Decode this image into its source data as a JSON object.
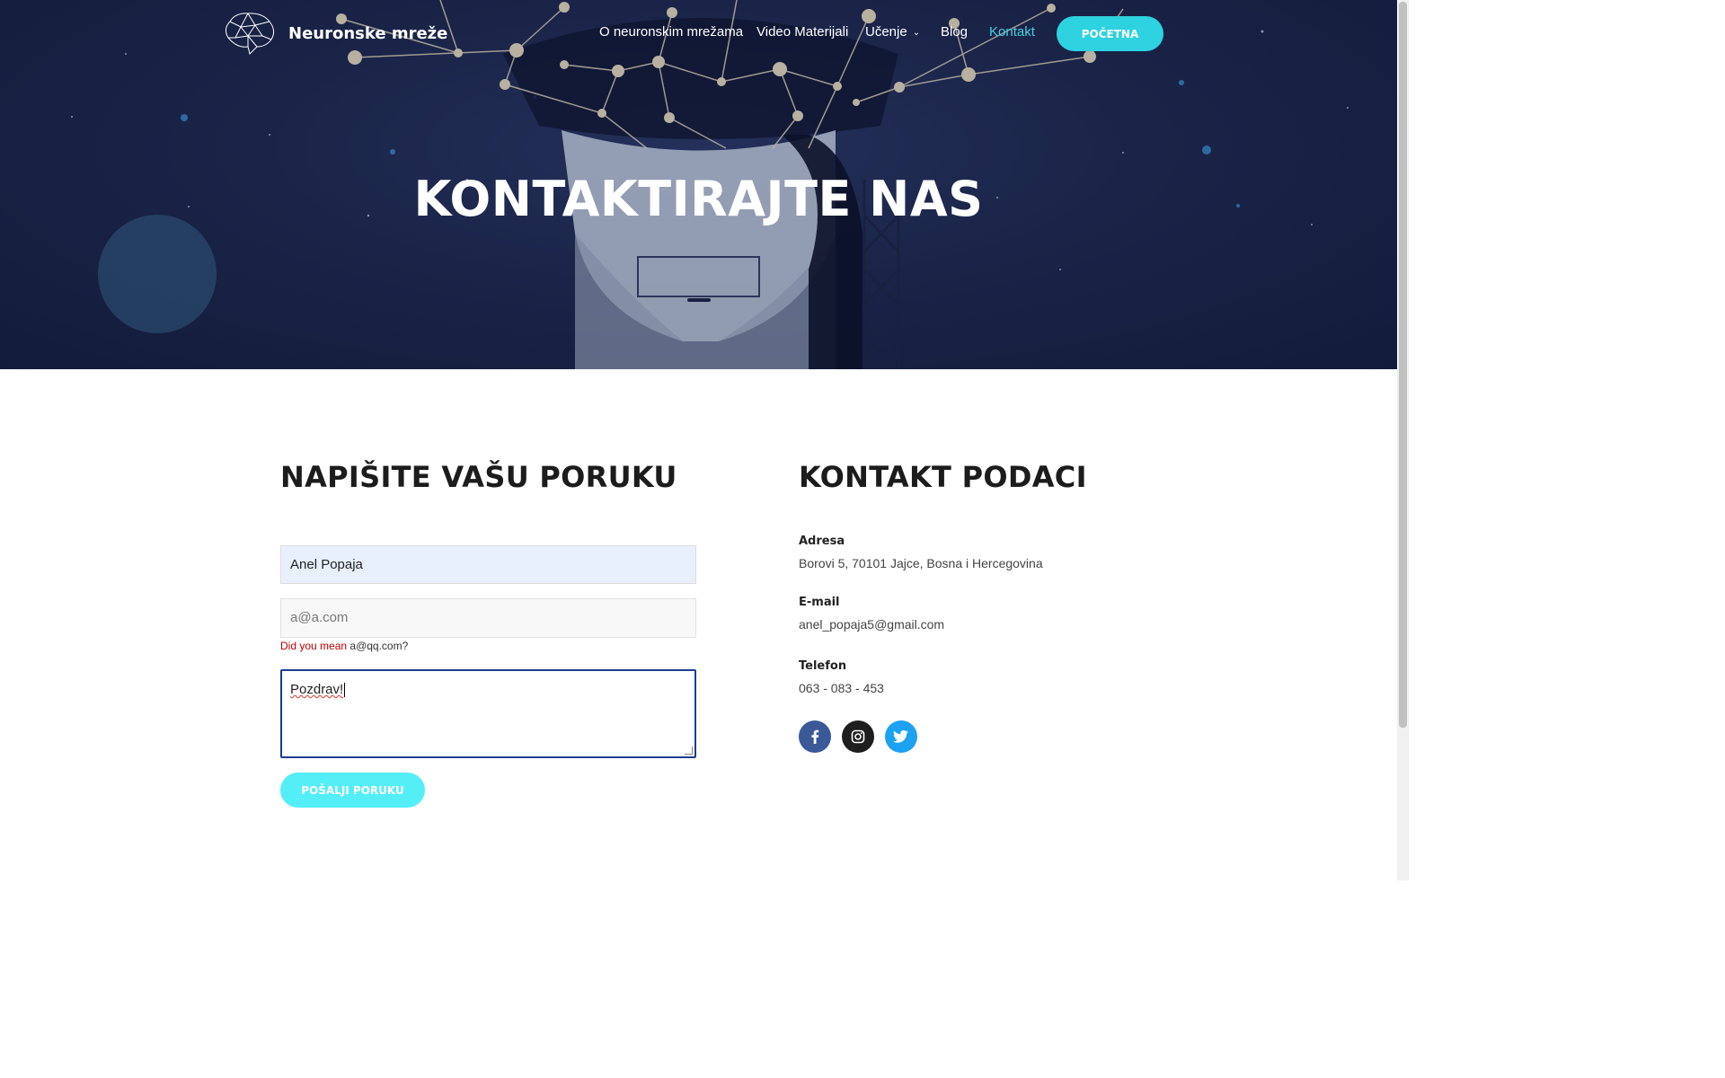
{
  "site": {
    "logo_text": "Neuronske mreže",
    "logo_icon": "brain-network-icon"
  },
  "nav": {
    "items": [
      {
        "label": "O neuronskim mrežama"
      },
      {
        "label": "Video Materijali"
      },
      {
        "label": "Učenje",
        "has_dropdown": true
      },
      {
        "label": "Blog"
      },
      {
        "label": "Kontakt",
        "active": true
      }
    ],
    "cta_label": "POČETNA"
  },
  "hero": {
    "title": "KONTAKTIRAJTE NAS"
  },
  "form": {
    "heading": "NAPIŠITE VAŠU PORUKU",
    "name_value": "Anel Popaja",
    "email_value": "a@a.com",
    "email_hint_prefix": "Did you mean",
    "email_hint_suggestion": "a@qq.com",
    "email_hint_suffix": "?",
    "message_value": "Pozdrav!",
    "submit_label": "POŠALJI PORUKU"
  },
  "contact": {
    "heading": "KONTAKT PODACI",
    "address_label": "Adresa",
    "address_value": "Borovi 5, 70101 Jajce, Bosna i Hercegovina",
    "email_label": "E-mail",
    "email_value": "anel_popaja5@gmail.com",
    "phone_label": "Telefon",
    "phone_value": "063 - 083 - 453",
    "social": [
      {
        "name": "facebook-icon",
        "color": "#3b5998"
      },
      {
        "name": "instagram-icon",
        "color": "#1e1e1e"
      },
      {
        "name": "twitter-icon",
        "color": "#1da1f2"
      }
    ]
  },
  "colors": {
    "accent": "#2ed2e0",
    "hero_bg": "#1a2448"
  }
}
